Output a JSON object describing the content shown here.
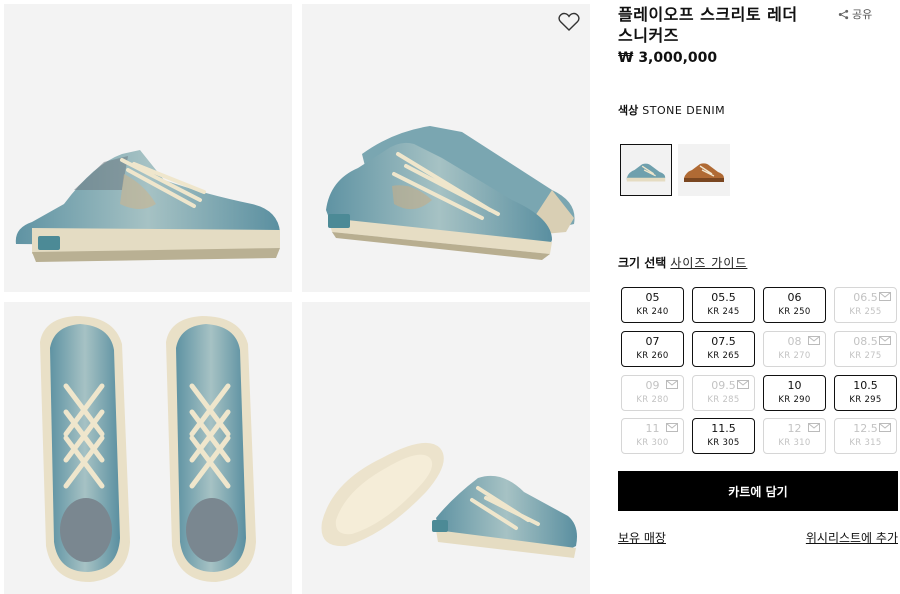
{
  "product": {
    "title": "플레이오프 스크리토 레더 스니커즈",
    "price": "₩ 3,000,000",
    "share_label": "공유"
  },
  "color": {
    "label": "색상",
    "value": "STONE DENIM",
    "swatches": [
      {
        "name": "stone-denim",
        "hex": "#6fa0ad",
        "selected": true
      },
      {
        "name": "tan-brown",
        "hex": "#b06a34",
        "selected": false
      }
    ]
  },
  "size": {
    "label": "크기 선택",
    "guide_label": "사이즈 가이드",
    "options": [
      {
        "us": "05",
        "kr": "KR 240",
        "available": true
      },
      {
        "us": "05.5",
        "kr": "KR 245",
        "available": true
      },
      {
        "us": "06",
        "kr": "KR 250",
        "available": true
      },
      {
        "us": "06.5",
        "kr": "KR 255",
        "available": false
      },
      {
        "us": "07",
        "kr": "KR 260",
        "available": true
      },
      {
        "us": "07.5",
        "kr": "KR 265",
        "available": true
      },
      {
        "us": "08",
        "kr": "KR 270",
        "available": false
      },
      {
        "us": "08.5",
        "kr": "KR 275",
        "available": false
      },
      {
        "us": "09",
        "kr": "KR 280",
        "available": false
      },
      {
        "us": "09.5",
        "kr": "KR 285",
        "available": false
      },
      {
        "us": "10",
        "kr": "KR 290",
        "available": true
      },
      {
        "us": "10.5",
        "kr": "KR 295",
        "available": true
      },
      {
        "us": "11",
        "kr": "KR 300",
        "available": false
      },
      {
        "us": "11.5",
        "kr": "KR 305",
        "available": true
      },
      {
        "us": "12",
        "kr": "KR 310",
        "available": false
      },
      {
        "us": "12.5",
        "kr": "KR 315",
        "available": false
      }
    ]
  },
  "actions": {
    "add_to_cart": "카트에 담기",
    "store_stock": "보유 매장",
    "add_wishlist": "위시리스트에 추가"
  },
  "icons": {
    "wishlist": "heart-icon",
    "share": "share-icon",
    "notify": "mail-icon"
  },
  "colors": {
    "accent": "#000000",
    "shoe_blue": "#6fa0ad",
    "sole": "#e5dcc2",
    "tile_bg": "#f3f3f3"
  }
}
